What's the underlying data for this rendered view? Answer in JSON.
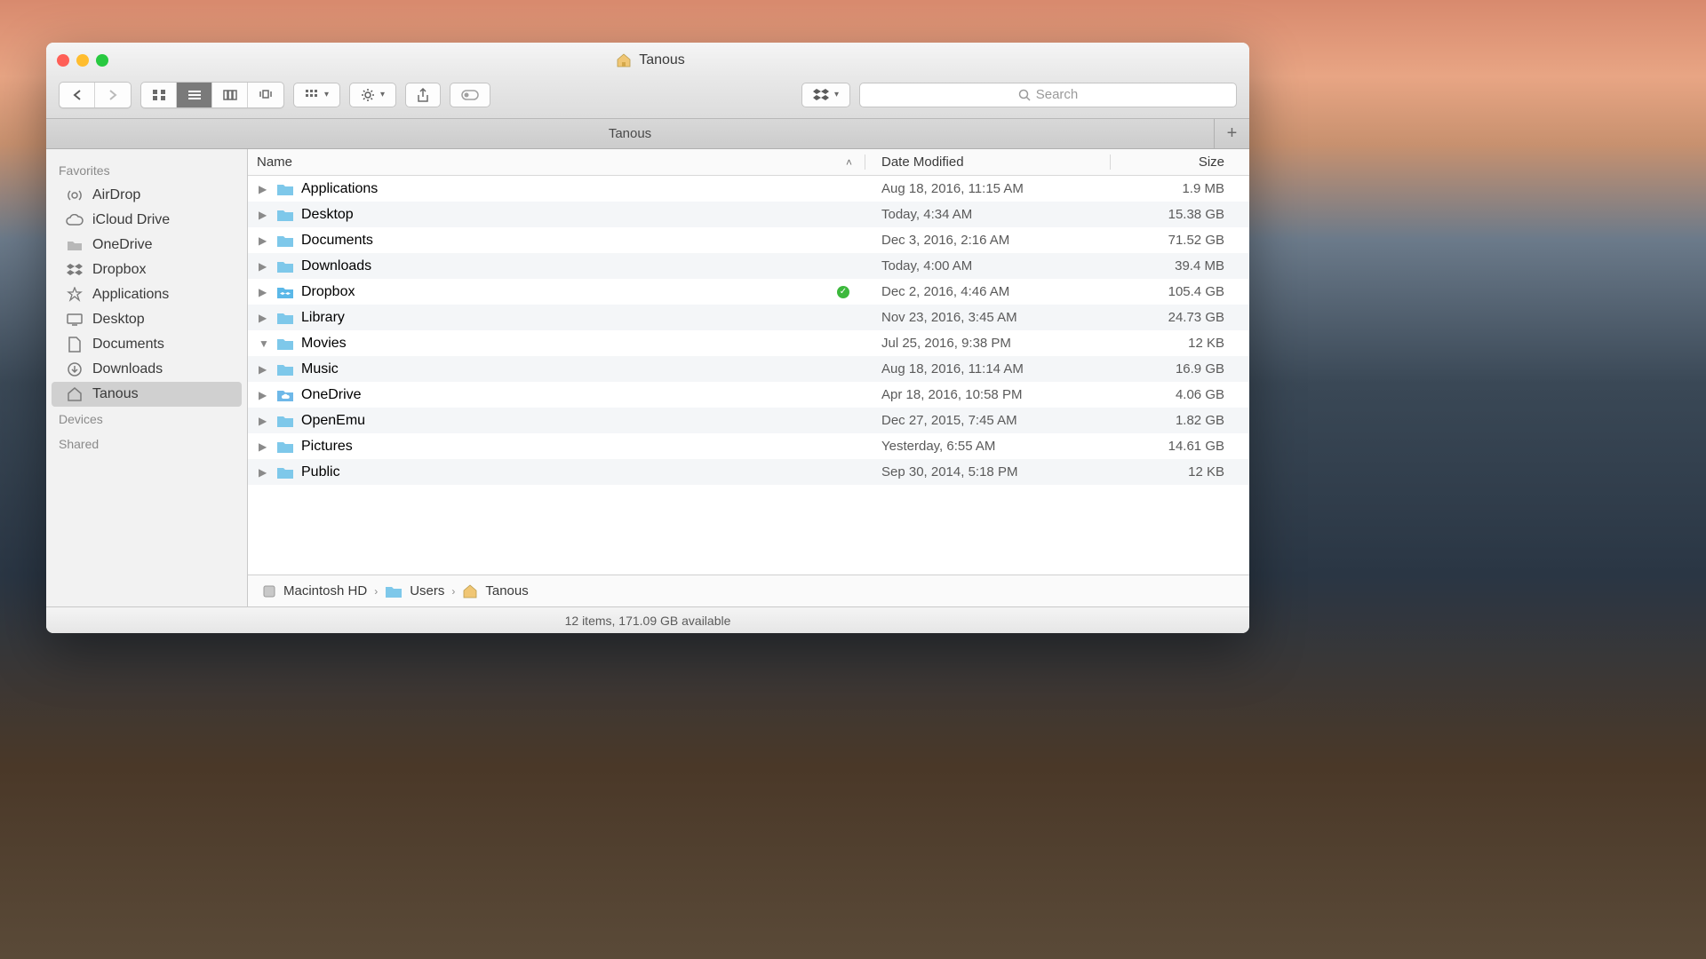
{
  "window": {
    "title": "Tanous"
  },
  "search": {
    "placeholder": "Search"
  },
  "tabbar": {
    "active": "Tanous"
  },
  "sidebar": {
    "sections": [
      {
        "header": "Favorites",
        "items": [
          {
            "label": "AirDrop",
            "icon": "airdrop"
          },
          {
            "label": "iCloud Drive",
            "icon": "cloud"
          },
          {
            "label": "OneDrive",
            "icon": "folder-gray"
          },
          {
            "label": "Dropbox",
            "icon": "dropbox"
          },
          {
            "label": "Applications",
            "icon": "apps"
          },
          {
            "label": "Desktop",
            "icon": "desktop"
          },
          {
            "label": "Documents",
            "icon": "documents"
          },
          {
            "label": "Downloads",
            "icon": "downloads"
          },
          {
            "label": "Tanous",
            "icon": "home",
            "selected": true
          }
        ]
      },
      {
        "header": "Devices",
        "items": []
      },
      {
        "header": "Shared",
        "items": []
      }
    ]
  },
  "columns": {
    "name": "Name",
    "date": "Date Modified",
    "size": "Size"
  },
  "files": [
    {
      "name": "Applications",
      "date": "Aug 18, 2016, 11:15 AM",
      "size": "1.9 MB",
      "icon": "folder",
      "expanded": false
    },
    {
      "name": "Desktop",
      "date": "Today, 4:34 AM",
      "size": "15.38 GB",
      "icon": "folder",
      "expanded": false
    },
    {
      "name": "Documents",
      "date": "Dec 3, 2016, 2:16 AM",
      "size": "71.52 GB",
      "icon": "folder",
      "expanded": false
    },
    {
      "name": "Downloads",
      "date": "Today, 4:00 AM",
      "size": "39.4 MB",
      "icon": "folder",
      "expanded": false
    },
    {
      "name": "Dropbox",
      "date": "Dec 2, 2016, 4:46 AM",
      "size": "105.4 GB",
      "icon": "dropbox-folder",
      "expanded": false,
      "synced": true
    },
    {
      "name": "Library",
      "date": "Nov 23, 2016, 3:45 AM",
      "size": "24.73 GB",
      "icon": "folder",
      "expanded": false
    },
    {
      "name": "Movies",
      "date": "Jul 25, 2016, 9:38 PM",
      "size": "12 KB",
      "icon": "folder",
      "expanded": true
    },
    {
      "name": "Music",
      "date": "Aug 18, 2016, 11:14 AM",
      "size": "16.9 GB",
      "icon": "folder",
      "expanded": false
    },
    {
      "name": "OneDrive",
      "date": "Apr 18, 2016, 10:58 PM",
      "size": "4.06 GB",
      "icon": "cloud-folder",
      "expanded": false
    },
    {
      "name": "OpenEmu",
      "date": "Dec 27, 2015, 7:45 AM",
      "size": "1.82 GB",
      "icon": "folder",
      "expanded": false
    },
    {
      "name": "Pictures",
      "date": "Yesterday, 6:55 AM",
      "size": "14.61 GB",
      "icon": "folder",
      "expanded": false
    },
    {
      "name": "Public",
      "date": "Sep 30, 2014, 5:18 PM",
      "size": "12 KB",
      "icon": "folder",
      "expanded": false
    }
  ],
  "pathbar": [
    {
      "label": "Macintosh HD",
      "icon": "disk"
    },
    {
      "label": "Users",
      "icon": "folder"
    },
    {
      "label": "Tanous",
      "icon": "home"
    }
  ],
  "statusbar": "12 items, 171.09 GB available"
}
